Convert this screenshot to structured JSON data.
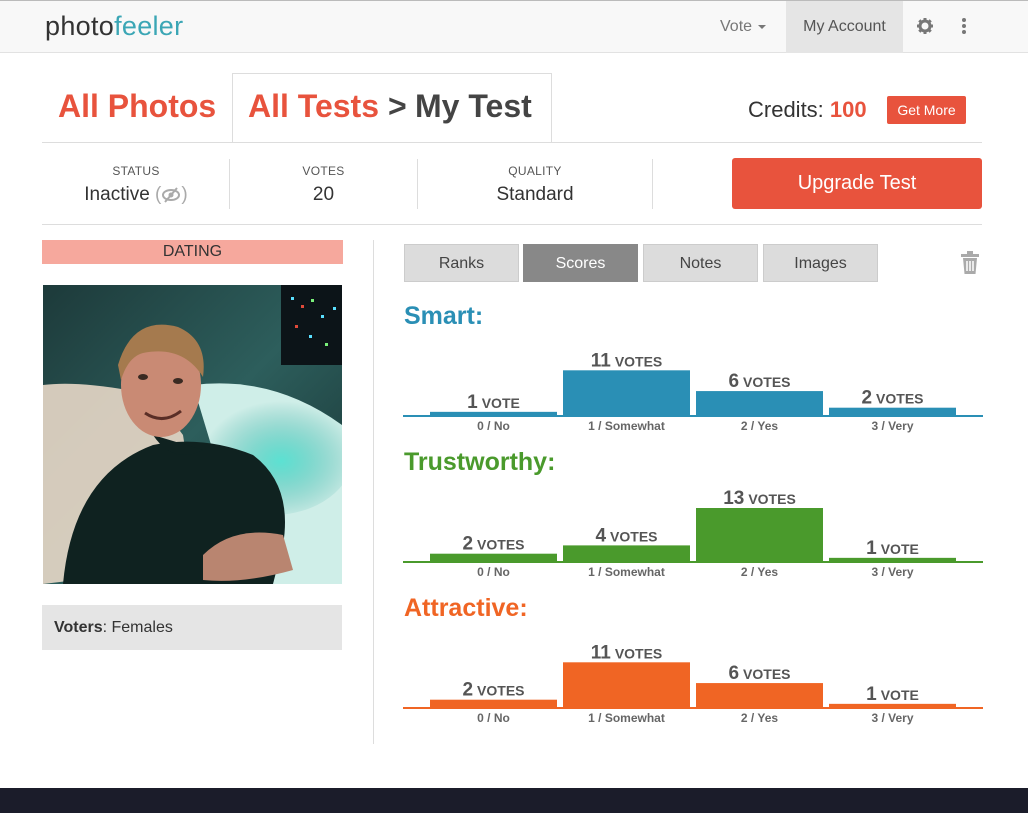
{
  "nav": {
    "logo_part1": "photo",
    "logo_part2": "feeler",
    "vote_label": "Vote",
    "account_label": "My Account",
    "gear_icon": "gear-icon",
    "menu_icon": "vertical-dots-icon"
  },
  "header": {
    "all_photos": "All Photos",
    "all_tests": "All Tests",
    "separator": ">",
    "my_test": "My Test",
    "credits_label": "Credits:",
    "credits_value": "100",
    "get_more": "Get More"
  },
  "stats": {
    "status_label": "STATUS",
    "status_value": "Inactive",
    "votes_label": "VOTES",
    "votes_value": "20",
    "quality_label": "QUALITY",
    "quality_value": "Standard",
    "upgrade_label": "Upgrade Test"
  },
  "left": {
    "category": "DATING",
    "voters_label": "Voters",
    "voters_value": ": Females"
  },
  "subtabs": [
    "Ranks",
    "Scores",
    "Notes",
    "Images"
  ],
  "active_subtab": "Scores",
  "colors": {
    "accent": "#e8533d",
    "smart": "#2a8fb5",
    "trustworthy": "#4a9a2c",
    "attractive": "#f06524"
  },
  "chart_data": [
    {
      "type": "bar",
      "title": "Smart:",
      "categories": [
        "0 / No",
        "1 / Somewhat",
        "2 / Yes",
        "3 / Very"
      ],
      "values": [
        1,
        11,
        6,
        2
      ],
      "labels": [
        {
          "num": "1",
          "unit": "VOTE"
        },
        {
          "num": "11",
          "unit": "VOTES"
        },
        {
          "num": "6",
          "unit": "VOTES"
        },
        {
          "num": "2",
          "unit": "VOTES"
        }
      ],
      "color": "#2a8fb5"
    },
    {
      "type": "bar",
      "title": "Trustworthy:",
      "categories": [
        "0 / No",
        "1 / Somewhat",
        "2 / Yes",
        "3 / Very"
      ],
      "values": [
        2,
        4,
        13,
        1
      ],
      "labels": [
        {
          "num": "2",
          "unit": "VOTES"
        },
        {
          "num": "4",
          "unit": "VOTES"
        },
        {
          "num": "13",
          "unit": "VOTES"
        },
        {
          "num": "1",
          "unit": "VOTE"
        }
      ],
      "color": "#4a9a2c"
    },
    {
      "type": "bar",
      "title": "Attractive:",
      "categories": [
        "0 / No",
        "1 / Somewhat",
        "2 / Yes",
        "3 / Very"
      ],
      "values": [
        2,
        11,
        6,
        1
      ],
      "labels": [
        {
          "num": "2",
          "unit": "VOTES"
        },
        {
          "num": "11",
          "unit": "VOTES"
        },
        {
          "num": "6",
          "unit": "VOTES"
        },
        {
          "num": "1",
          "unit": "VOTE"
        }
      ],
      "color": "#f06524"
    }
  ]
}
